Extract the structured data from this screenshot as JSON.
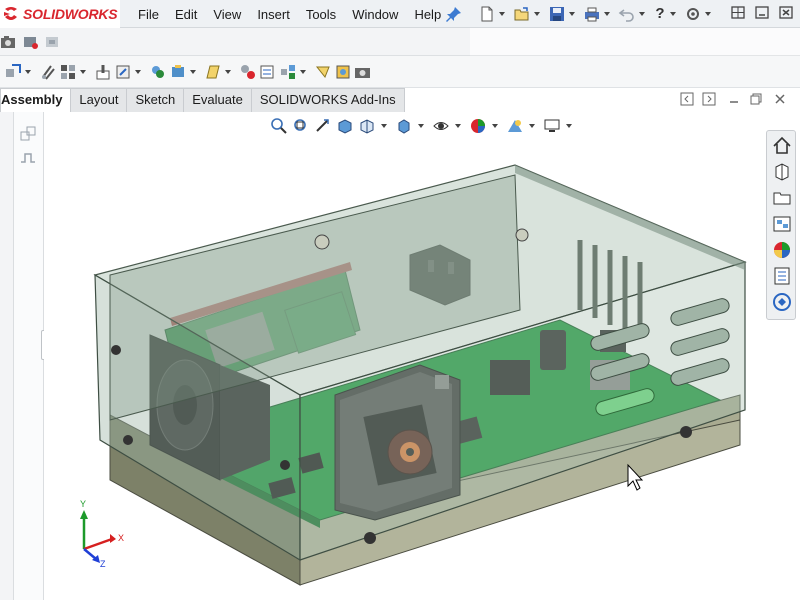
{
  "app": {
    "logo_text": "SOLIDWORKS",
    "brand_color": "#d9262e"
  },
  "menu": [
    "File",
    "Edit",
    "View",
    "Insert",
    "Tools",
    "Window",
    "Help"
  ],
  "tabs": [
    {
      "label": "Assembly",
      "active": true
    },
    {
      "label": "Layout",
      "active": false
    },
    {
      "label": "Sketch",
      "active": false
    },
    {
      "label": "Evaluate",
      "active": false
    },
    {
      "label": "SOLIDWORKS Add-Ins",
      "active": false
    }
  ],
  "toolbar": {
    "help_label": "?",
    "right_icons": [
      "new-document-icon",
      "open-icon",
      "save-icon",
      "print-icon",
      "undo-icon",
      "help-icon",
      "options-icon"
    ],
    "command_icons": [
      "insert-components-icon",
      "mate-icon",
      "linear-pattern-icon",
      "smart-fasteners-icon",
      "move-component-icon",
      "show-hidden-icon",
      "assembly-features-icon",
      "reference-geometry-icon",
      "new-motion-study-icon",
      "bill-of-materials-icon",
      "exploded-view-icon",
      "instant3d-icon",
      "snapshot-icon"
    ]
  },
  "heads_up_icons": [
    "zoom-to-fit-icon",
    "zoom-to-area-icon",
    "previous-view-icon",
    "section-view-icon",
    "view-orientation-icon",
    "display-style-icon",
    "hide-show-icon",
    "edit-appearance-icon",
    "apply-scene-icon",
    "view-settings-icon"
  ],
  "task_pane_icons": [
    "home-icon",
    "design-library-icon",
    "file-explorer-icon",
    "view-palette-icon",
    "appearances-icon",
    "custom-properties-icon",
    "solidworks-forum-icon"
  ],
  "triad": {
    "x_label": "X",
    "y_label": "Y",
    "z_label": "Z",
    "x_color": "#d62020",
    "y_color": "#1d9a2a",
    "z_color": "#1f3fd6"
  },
  "model": {
    "enclosure_color": "#8fa99a",
    "pcb_color": "#1d9a3e",
    "base_color": "#a8aa92"
  }
}
